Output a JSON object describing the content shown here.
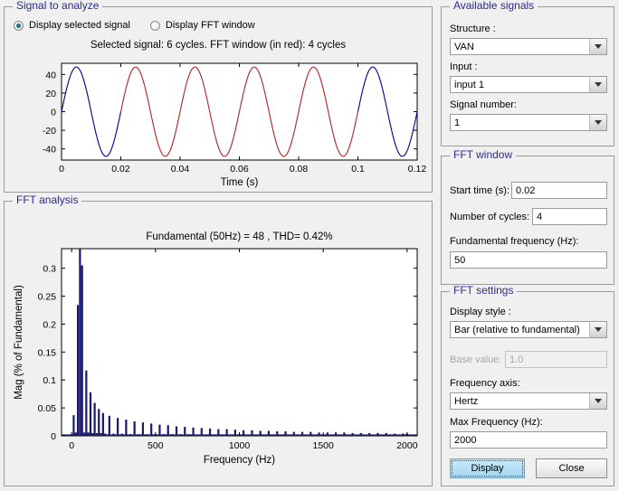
{
  "signal_panel": {
    "legend": "Signal to analyze",
    "radios": [
      {
        "label": "Display selected signal",
        "checked": true
      },
      {
        "label": "Display FFT window",
        "checked": false
      }
    ],
    "plot_title": "Selected signal: 6 cycles. FFT window (in red): 4 cycles"
  },
  "fft_panel": {
    "legend": "FFT analysis"
  },
  "available_signals": {
    "legend": "Available signals",
    "structure_label": "Structure :",
    "structure_value": "VAN",
    "input_label": "Input :",
    "input_value": "input 1",
    "signal_number_label": "Signal number:",
    "signal_number_value": "1"
  },
  "fft_window": {
    "legend": "FFT window",
    "start_time_label": "Start time (s):",
    "start_time_value": "0.02",
    "cycles_label": "Number of cycles:",
    "cycles_value": "4",
    "fundamental_label": "Fundamental frequency (Hz):",
    "fundamental_value": "50"
  },
  "fft_settings": {
    "legend": "FFT settings",
    "display_style_label": "Display style :",
    "display_style_value": "Bar (relative to fundamental)",
    "base_value_label": "Base value:",
    "base_value_value": "1.0",
    "freq_axis_label": "Frequency axis:",
    "freq_axis_value": "Hertz",
    "max_freq_label": "Max Frequency (Hz):",
    "max_freq_value": "2000",
    "display_button": "Display",
    "close_button": "Close"
  },
  "colors": {
    "signal_blue": "#00008B",
    "signal_red": "#B22222",
    "bar_blue": "#191970",
    "legend_text": "#2b2b8f",
    "panel_bg": "#f0f0f0",
    "axes_bg": "#ffffff"
  },
  "chart_data": [
    {
      "type": "line",
      "name": "selected-signal",
      "title": "Selected signal: 6 cycles. FFT window (in red): 4 cycles",
      "xlabel": "Time (s)",
      "ylabel": "",
      "xlim": [
        0,
        0.12
      ],
      "ylim": [
        -52,
        52
      ],
      "xticks": [
        0,
        0.02,
        0.04,
        0.06,
        0.08,
        0.1,
        0.12
      ],
      "xticklabels": [
        "0",
        "0.02",
        "0.04",
        "0.06",
        "0.08",
        "0.1",
        "0.12"
      ],
      "yticks": [
        -40,
        -20,
        0,
        20,
        40
      ],
      "yticklabels": [
        "-40",
        "-20",
        "0",
        "20",
        "40"
      ],
      "grid": false,
      "waveform": {
        "shape": "sine",
        "amplitude": 48,
        "frequency_hz": 50,
        "cycles": 6,
        "phase_deg": 0
      },
      "series": [
        {
          "name": "signal-outside-window",
          "color": "#00008B",
          "segments": [
            [
              0,
              0.02
            ],
            [
              0.1,
              0.12
            ]
          ]
        },
        {
          "name": "fft-window-highlight",
          "color": "#B22222",
          "segments": [
            [
              0.02,
              0.1
            ]
          ]
        }
      ]
    },
    {
      "type": "bar",
      "name": "fft-spectrum",
      "title": "Fundamental (50Hz) = 48 , THD= 0.42%",
      "xlabel": "Frequency (Hz)",
      "ylabel": "Mag (% of Fundamental)",
      "xlim": [
        -60,
        2060
      ],
      "ylim": [
        0,
        0.335
      ],
      "xticks": [
        0,
        500,
        1000,
        1500,
        2000
      ],
      "xticklabels": [
        "0",
        "500",
        "1000",
        "1500",
        "2000"
      ],
      "yticks": [
        0,
        0.05,
        0.1,
        0.15,
        0.2,
        0.25,
        0.3
      ],
      "yticklabels": [
        "0",
        "0.05",
        "0.1",
        "0.15",
        "0.2",
        "0.25",
        "0.3"
      ],
      "grid": false,
      "fundamental_hz": 50,
      "fundamental_magnitude": 48,
      "thd_percent": 0.42,
      "note": "Fundamental bar at 50 Hz is clipped at top of axis (value 100% of fundamental)",
      "x": [
        12.5,
        25,
        37.5,
        50,
        62.5,
        75,
        87.5,
        100,
        112.5,
        125,
        137.5,
        150,
        162.5,
        175,
        187.5,
        200,
        225,
        250,
        275,
        300,
        325,
        350,
        375,
        400,
        425,
        450,
        475,
        500,
        525,
        550,
        575,
        600,
        625,
        650,
        675,
        700,
        725,
        750,
        775,
        800,
        825,
        850,
        875,
        900,
        925,
        950,
        975,
        1000,
        1025,
        1050,
        1075,
        1100,
        1125,
        1150,
        1175,
        1200,
        1225,
        1250,
        1275,
        1300,
        1325,
        1350,
        1375,
        1400,
        1425,
        1450,
        1475,
        1500,
        1525,
        1550,
        1575,
        1600,
        1625,
        1650,
        1675,
        1700,
        1725,
        1750,
        1775,
        1800,
        1825,
        1850,
        1875,
        1900,
        1925,
        1950,
        1975,
        2000
      ],
      "values": [
        0.037,
        0.006,
        0.234,
        0.335,
        0.305,
        0.006,
        0.117,
        0.006,
        0.078,
        0.005,
        0.059,
        0.005,
        0.048,
        0.005,
        0.041,
        0.004,
        0.036,
        0.004,
        0.032,
        0.004,
        0.029,
        0.003,
        0.026,
        0.003,
        0.024,
        0.003,
        0.022,
        0.003,
        0.02,
        0.003,
        0.019,
        0.003,
        0.017,
        0.003,
        0.016,
        0.003,
        0.015,
        0.002,
        0.014,
        0.002,
        0.013,
        0.002,
        0.012,
        0.002,
        0.012,
        0.002,
        0.011,
        0.002,
        0.01,
        0.002,
        0.01,
        0.002,
        0.009,
        0.002,
        0.009,
        0.002,
        0.008,
        0.002,
        0.008,
        0.002,
        0.007,
        0.002,
        0.007,
        0.002,
        0.007,
        0.001,
        0.006,
        0.001,
        0.006,
        0.001,
        0.006,
        0.001,
        0.006,
        0.001,
        0.005,
        0.001,
        0.005,
        0.001,
        0.005,
        0.001,
        0.005,
        0.001,
        0.005,
        0.001,
        0.004,
        0.001,
        0.004,
        0.004
      ]
    }
  ]
}
